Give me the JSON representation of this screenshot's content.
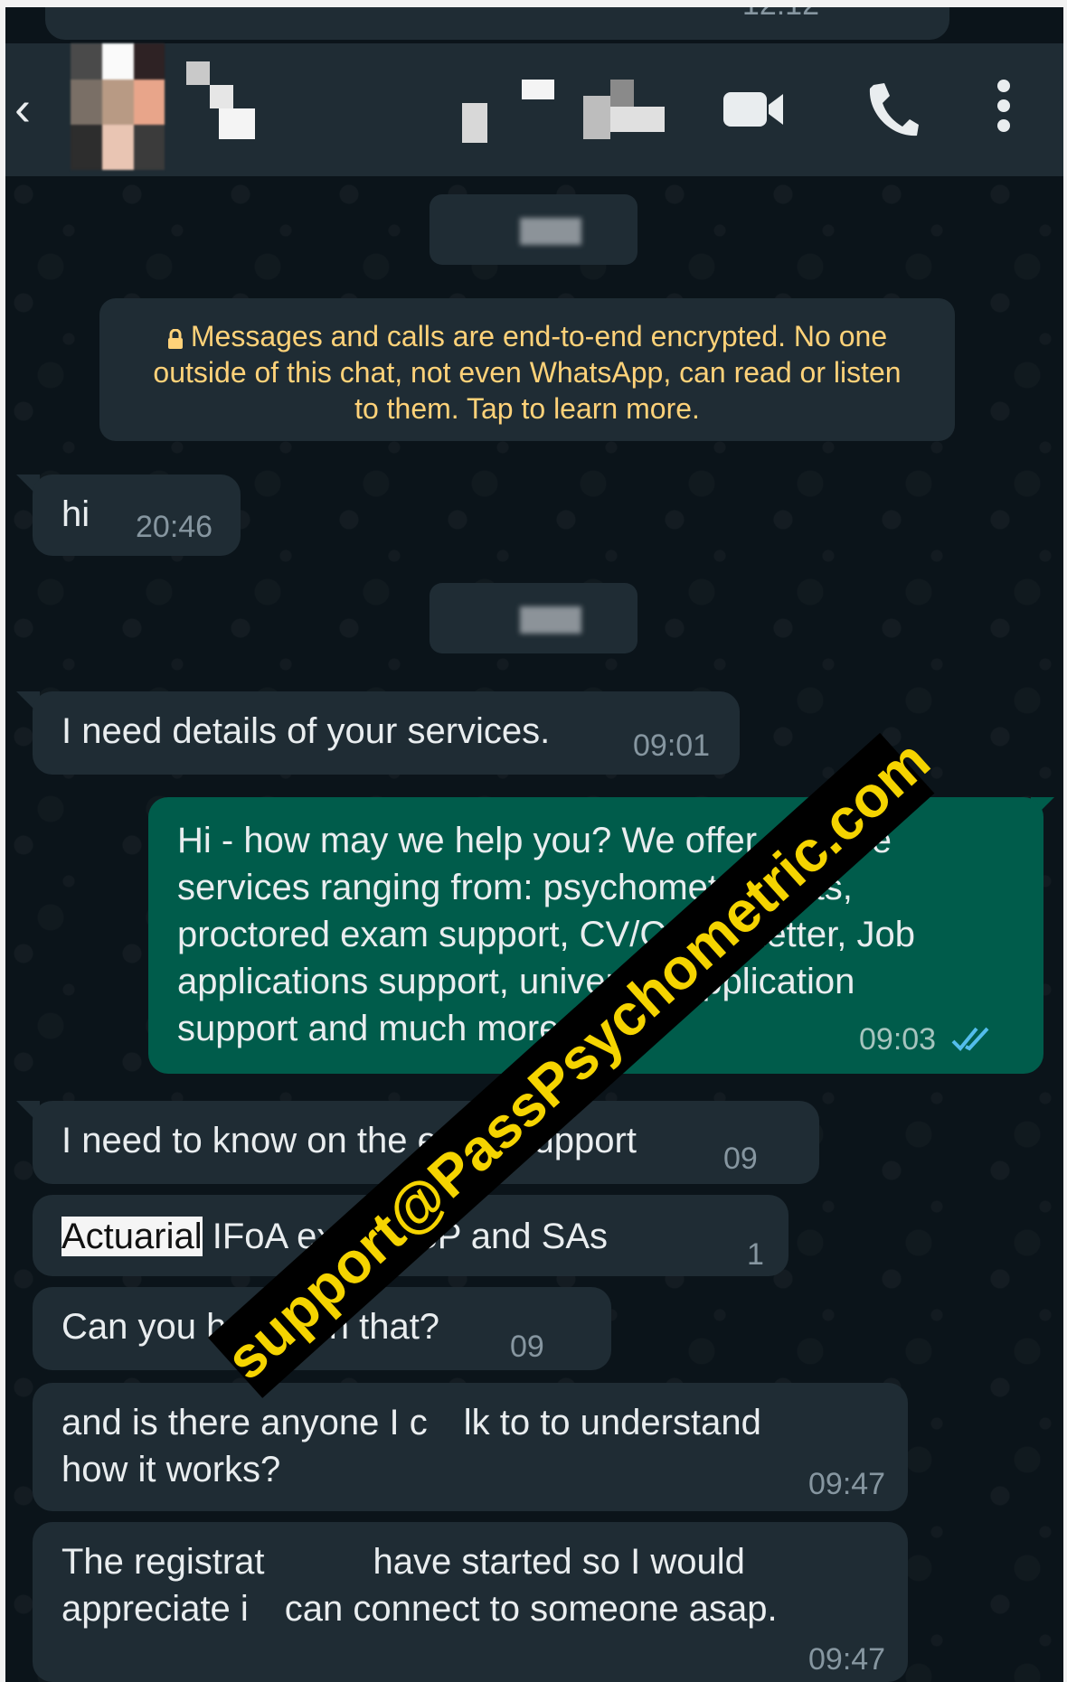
{
  "top": {
    "prev_time": "12:12"
  },
  "header": {
    "back_icon": "arrow-left-icon",
    "video_icon": "video-call-icon",
    "call_icon": "phone-icon",
    "menu_icon": "more-vertical-icon"
  },
  "encryption_notice": {
    "line1": "Messages and calls are end-to-end encrypted. No one",
    "line2": "outside of this chat, not even WhatsApp, can read or listen",
    "line3": "to them. Tap to learn more."
  },
  "messages": [
    {
      "direction": "in",
      "text": "hi",
      "time": "20:46"
    },
    {
      "direction": "in",
      "text": "I need details of your services.",
      "time": "09:01"
    },
    {
      "direction": "out",
      "lines": [
        "Hi - how may we help you? We offer multiple",
        "services ranging from: psychometric tests,",
        "proctored exam support, CV/Cover Letter, Job",
        "applications support, university application",
        "support and much more."
      ],
      "time": "09:03",
      "status": "read"
    },
    {
      "direction": "in",
      "text": "I need to know on the exam support",
      "time": "09"
    },
    {
      "direction": "in",
      "highlight": "Actuarial",
      "text": " IFoA exams SP and SAs",
      "time": "1"
    },
    {
      "direction": "in",
      "text": "Can you help with that?",
      "time": "09"
    },
    {
      "direction": "in",
      "lines": [
        "and is there anyone I c",
        "how it works?"
      ],
      "line1_tail": "lk to to understand",
      "time": "09:47"
    },
    {
      "direction": "in",
      "line1_a": "The registrat",
      "line1_b": "have started so I would",
      "line2_a": "appreciate i",
      "line2_b": "can connect to someone asap.",
      "time": "09:47"
    }
  ],
  "watermark": "support@PassPsychometric.com",
  "colors": {
    "background": "#0b141a",
    "incoming_bubble": "#1f2c34",
    "outgoing_bubble": "#005c4b",
    "notice_text": "#ffd279",
    "read_ticks": "#53bdeb",
    "watermark_text": "#f5d400"
  }
}
